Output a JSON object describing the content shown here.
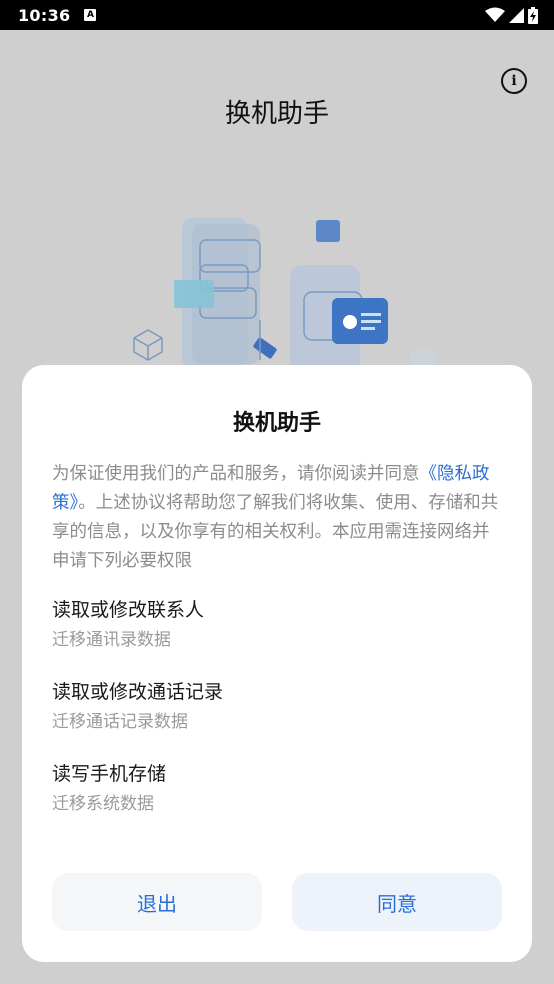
{
  "status_bar": {
    "time": "10:36",
    "notification_icon": "A",
    "icons": [
      "wifi-icon",
      "cell-signal-icon",
      "battery-charging-icon"
    ]
  },
  "app": {
    "title": "换机助手",
    "info_icon": "info-icon"
  },
  "dialog": {
    "title": "换机助手",
    "body_prefix": "为保证使用我们的产品和服务，请你阅读并同意",
    "policy_link": "《隐私政策》",
    "body_suffix": "。上述协议将帮助您了解我们将收集、使用、存储和共享的信息，以及你享有的相关权利。本应用需连接网络并申请下列必要权限",
    "permissions": [
      {
        "title": "读取或修改联系人",
        "desc": "迁移通讯录数据"
      },
      {
        "title": "读取或修改通话记录",
        "desc": "迁移通话记录数据"
      },
      {
        "title": "读写手机存储",
        "desc": "迁移系统数据"
      }
    ],
    "exit_label": "退出",
    "agree_label": "同意"
  },
  "colors": {
    "accent": "#2a6fd4",
    "background": "#cfcfcf",
    "dialog": "#ffffff"
  }
}
